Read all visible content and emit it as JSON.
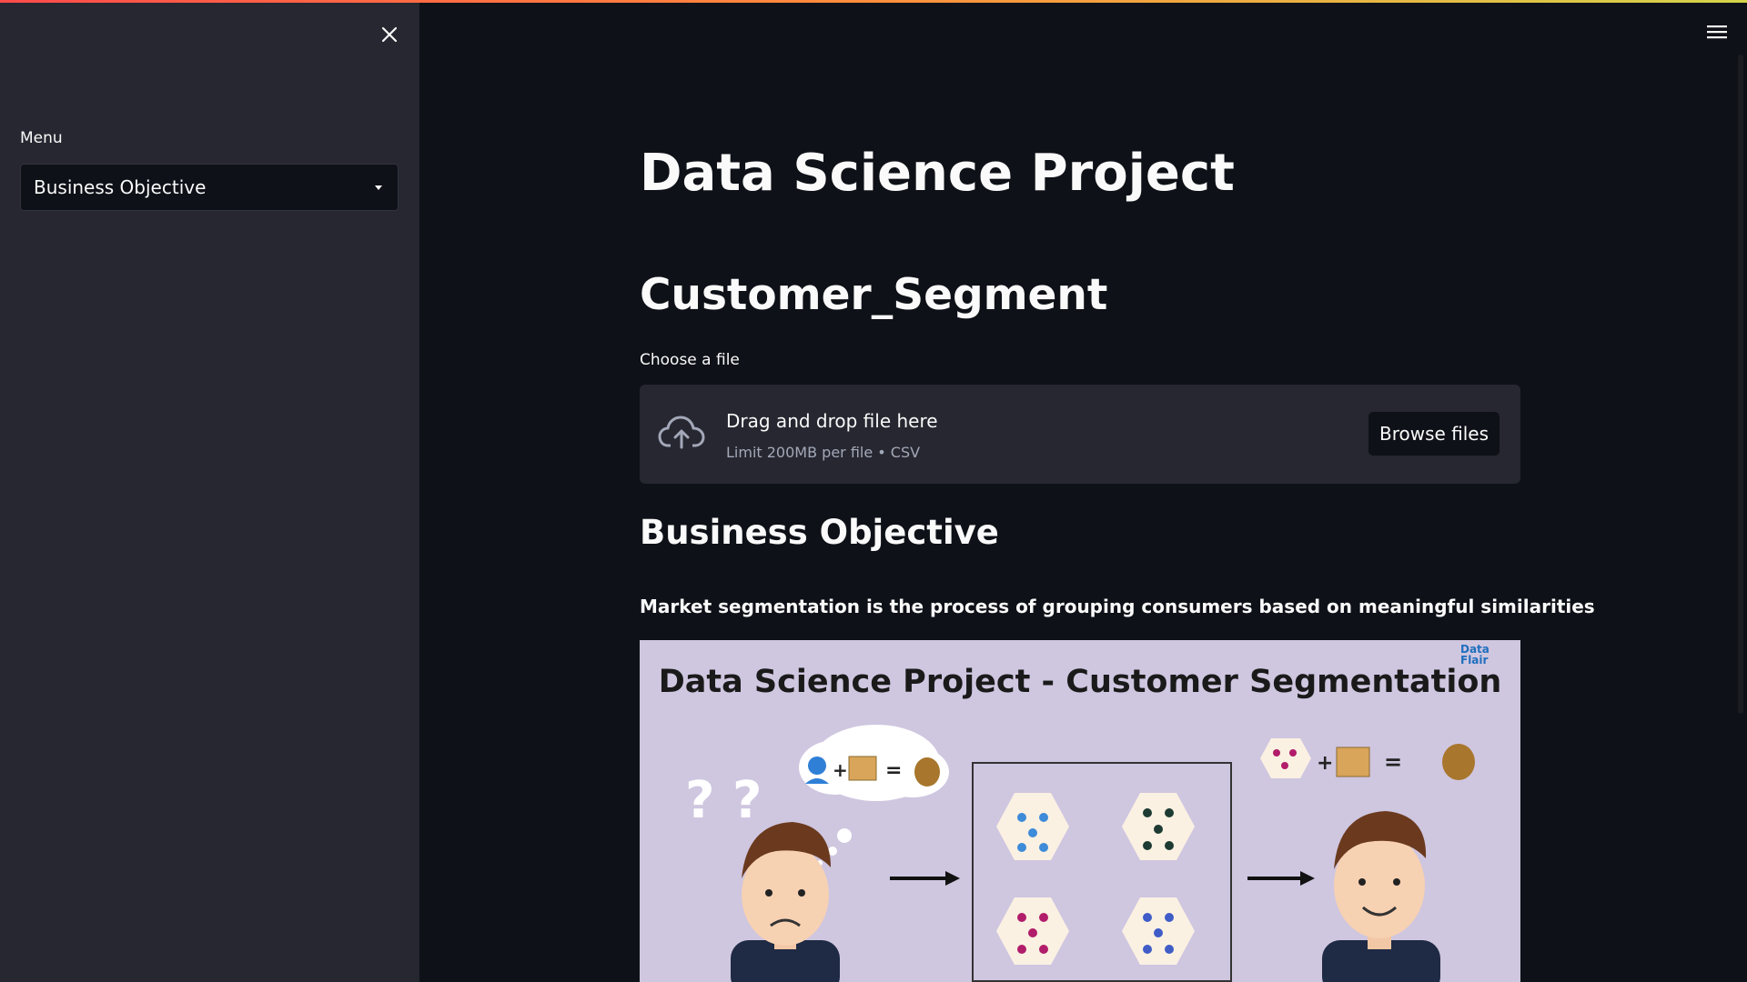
{
  "sidebar": {
    "menu_label": "Menu",
    "select_value": "Business Objective"
  },
  "main": {
    "title": "Data Science Project",
    "subtitle": "Customer_Segment",
    "uploader": {
      "label": "Choose a file",
      "drag_text": "Drag and drop file here",
      "limit_text": "Limit 200MB per file • CSV",
      "browse_label": "Browse files"
    },
    "section_heading": "Business Objective",
    "description": "Market segmentation is the process of grouping consumers based on meaningful similarities",
    "figure": {
      "title": "Data Science Project - Customer Segmentation",
      "logo_line1": "Data",
      "logo_line2": "Flair"
    }
  },
  "colors": {
    "background": "#0e1117",
    "sidebar": "#262730",
    "accent_gradient_start": "#ff4b4b",
    "accent_gradient_end": "#d4d44a",
    "figure_background": "#cfc6e0"
  },
  "icons": [
    "close-icon",
    "hamburger-icon",
    "upload-cloud-icon",
    "chevron-down-icon"
  ]
}
